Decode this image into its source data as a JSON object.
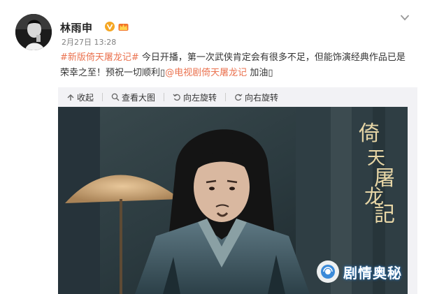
{
  "post": {
    "username": "林雨申",
    "timestamp": "2月27日 13:28",
    "hashtag": "#新版倚天屠龙记#",
    "text_part1": " 今日开播，第一次武侠肯定会有很多不足，但能饰演经典作品已是荣幸之至！预祝一切顺利",
    "mention": "@电视剧倚天屠龙记",
    "text_part2": " 加油"
  },
  "toolbar": {
    "collapse_label": "收起",
    "view_large_label": "查看大图",
    "rotate_left_label": "向左旋转",
    "rotate_right_label": "向右旋转"
  },
  "watermark": {
    "text": "剧情奥秘"
  },
  "icons": {
    "verified": "verified-v-icon",
    "vip": "vip-crown-icon",
    "more": "chevron-down-icon",
    "collapse": "collapse-arrow-icon",
    "view_large": "magnifier-icon",
    "rotate_left": "rotate-left-icon",
    "rotate_right": "rotate-right-icon"
  },
  "colors": {
    "link": "#eb7350",
    "verified": "#f5a623",
    "toolbar_bg": "#f2f2f5"
  }
}
